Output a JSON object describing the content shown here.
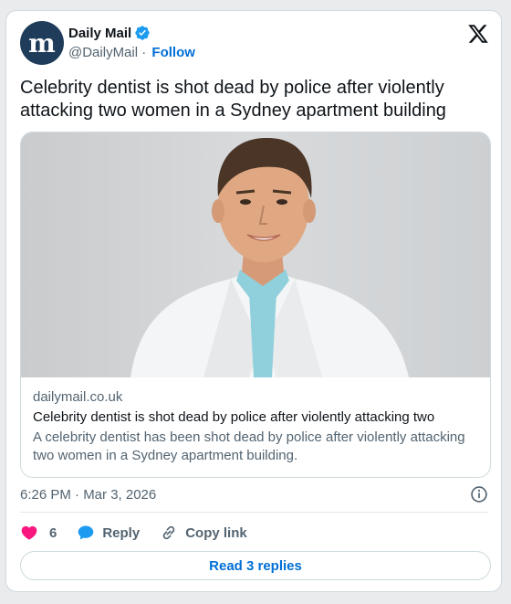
{
  "author": {
    "display_name": "Daily Mail",
    "handle": "@DailyMail",
    "separator": "·",
    "follow_label": "Follow",
    "avatar_icon": "daily-mail-logo",
    "avatar_letters": "m"
  },
  "tweet": {
    "text": "Celebrity dentist is shot dead by police after violently attacking two women in a Sydney apartment building",
    "timestamp": "6:26 PM · Mar 3, 2026"
  },
  "link_card": {
    "domain": "dailymail.co.uk",
    "title": "Celebrity dentist is shot dead by police after violently attacking two",
    "description": "A celebrity dentist has been shot dead by police after violently attacking two women in a Sydney apartment building."
  },
  "actions": {
    "like_count": "6",
    "reply_label": "Reply",
    "copy_label": "Copy link"
  },
  "footer": {
    "read_replies_label": "Read 3 replies"
  },
  "colors": {
    "accent": "#006fd6",
    "verified": "#1d9bf0",
    "heart": "#f91880",
    "avatar_bg": "#1f3c5a"
  }
}
